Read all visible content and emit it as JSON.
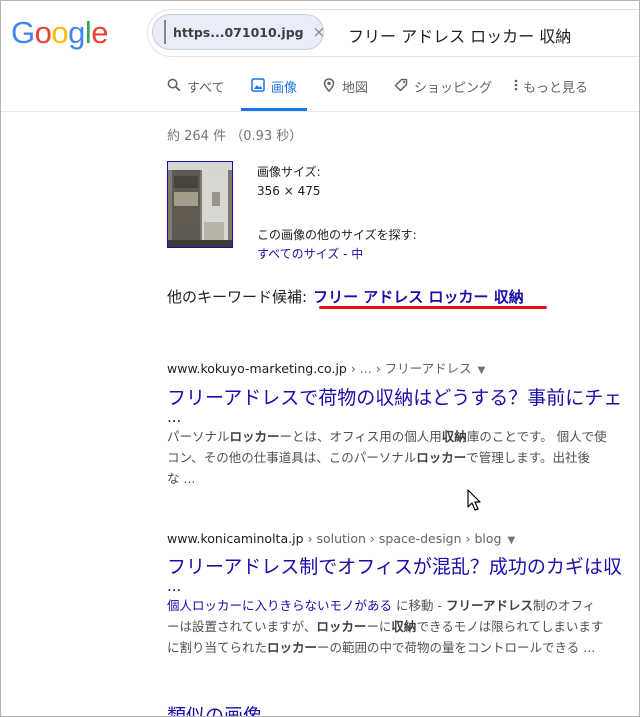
{
  "header": {
    "logo_letters": [
      {
        "ch": "G",
        "color": "#4285f4"
      },
      {
        "ch": "o",
        "color": "#ea4335"
      },
      {
        "ch": "o",
        "color": "#fbbc05"
      },
      {
        "ch": "g",
        "color": "#4285f4"
      },
      {
        "ch": "l",
        "color": "#34a853"
      },
      {
        "ch": "e",
        "color": "#ea4335"
      }
    ],
    "chip_label": "https...071010.jpg",
    "chip_close": "×",
    "query": "フリー アドレス ロッカー 収納"
  },
  "tabs": [
    {
      "label": "すべて",
      "icon": "search-icon",
      "active": false
    },
    {
      "label": "画像",
      "icon": "image-icon",
      "active": true
    },
    {
      "label": "地図",
      "icon": "map-pin-icon",
      "active": false
    },
    {
      "label": "ショッピング",
      "icon": "tag-icon",
      "active": false
    },
    {
      "label": "もっと見る",
      "icon": "more-vert-icon",
      "active": false
    }
  ],
  "stats": "約 264 件 （0.93 秒）",
  "image_info": {
    "size_label": "画像サイズ:",
    "size_value": "356 × 475",
    "other_sizes_label": "この画像の他のサイズを探す:",
    "all_sizes_link": "すべてのサイズ",
    "separator": " - ",
    "medium_link": "中"
  },
  "keyword": {
    "label": "他のキーワード候補:",
    "link": "フリー アドレス ロッカー 収納"
  },
  "results": [
    {
      "domain": "www.kokuyo-marketing.co.jp",
      "path": " › ... › フリーアドレス",
      "title": "フリーアドレスで荷物の収納はどうする？事前にチェ",
      "ellipsis": "...",
      "snippet": [
        [
          "パーソナル",
          "ロッカー",
          "ーとは、オフィス用の個人用",
          "収納",
          "庫のことです。 個人で使"
        ],
        [
          "コン、その他の仕事道具は、このパーソナル",
          "ロッカー",
          "で管理します。出社後"
        ],
        [
          "な ..."
        ]
      ]
    },
    {
      "domain": "www.konicaminolta.jp",
      "path": " › solution › space-design › blog",
      "title": "フリーアドレス制でオフィスが混乱？成功のカギは収",
      "ellipsis": "...",
      "jump_link": "個人ロッカーに入りきらないモノがある",
      "snippet": [
        [
          " に移動 - ",
          "フリーアドレス",
          "制のオフィ"
        ],
        [
          "ーは設置されていますが、",
          "ロッカー",
          "ーに",
          "収納",
          "できるモノは限られてしまいます"
        ],
        [
          "に割り当てられた",
          "ロッカー",
          "ーの範囲の中で荷物の量をコントロールできる ..."
        ]
      ]
    }
  ],
  "similar_images": "類似の画像"
}
